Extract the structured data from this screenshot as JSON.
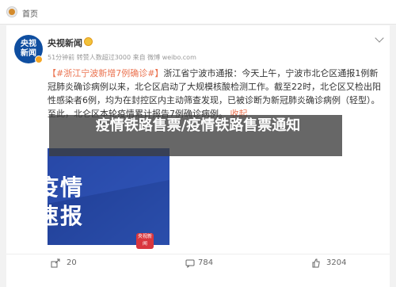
{
  "topbar": {
    "home_label": "首页"
  },
  "post": {
    "author": "央视新闻",
    "avatar_text": [
      "央视",
      "新闻"
    ],
    "meta_line": "51分钟前 转赞人数超过3000  来自 微博 weibo.com",
    "tag": "【#浙江宁波新增7例确诊#】",
    "text": "浙江省宁波市通报：今天上午，宁波市北仑区通报1例新冠肺炎确诊病例以来，北仑区启动了大规模核酸检测工作。截至22时，北仑区又检出阳性感染者6例，均为在封控区内主动筛查发现，已被诊断为新冠肺炎确诊病例（轻型）。至此，北仑区本轮疫情累计报告7例确诊病例。",
    "more_label": "收起",
    "image": {
      "line1": "疫情",
      "line2": "速报",
      "badge": "央视新闻"
    }
  },
  "overlay": {
    "title": "疫情铁路售票/疫情铁路售票通知"
  },
  "actions": {
    "share": "20",
    "comment": "784",
    "like": "3204"
  }
}
